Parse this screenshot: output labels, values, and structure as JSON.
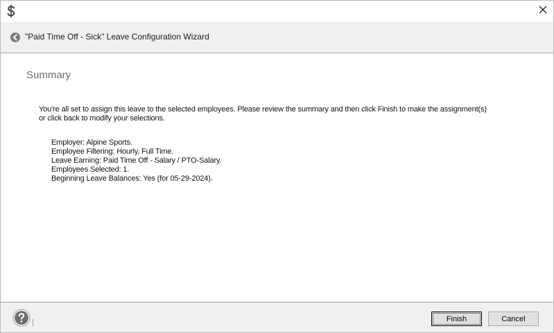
{
  "window": {
    "app_icon": "dollar-sign-icon",
    "close_icon": "close-icon"
  },
  "header": {
    "back_icon": "back-arrow-icon",
    "title": "\"Paid Time Off - Sick\" Leave Configuration Wizard"
  },
  "summary": {
    "section_title": "Summary",
    "intro_line1": "You're all set to assign this leave to the selected employees. Please review the summary and then click Finish to make the assignment(s)",
    "intro_line2": "or click back to modify your selections.",
    "details": [
      "Employer: Alpine Sports.",
      "Employee Filtering: Hourly, Full Time.",
      "Leave Earning: Paid Time Off - Salary / PTO-Salary.",
      "Employees Selected: 1.",
      "Beginning Leave Balances: Yes (for 05-29-2024)."
    ]
  },
  "footer": {
    "help_icon": "help-icon",
    "finish_label": "Finish",
    "cancel_label": "Cancel"
  },
  "colors": {
    "band_bg": "#f0f0f0",
    "section_title": "#6d6d6d",
    "button_bg": "#e1e1e1"
  }
}
